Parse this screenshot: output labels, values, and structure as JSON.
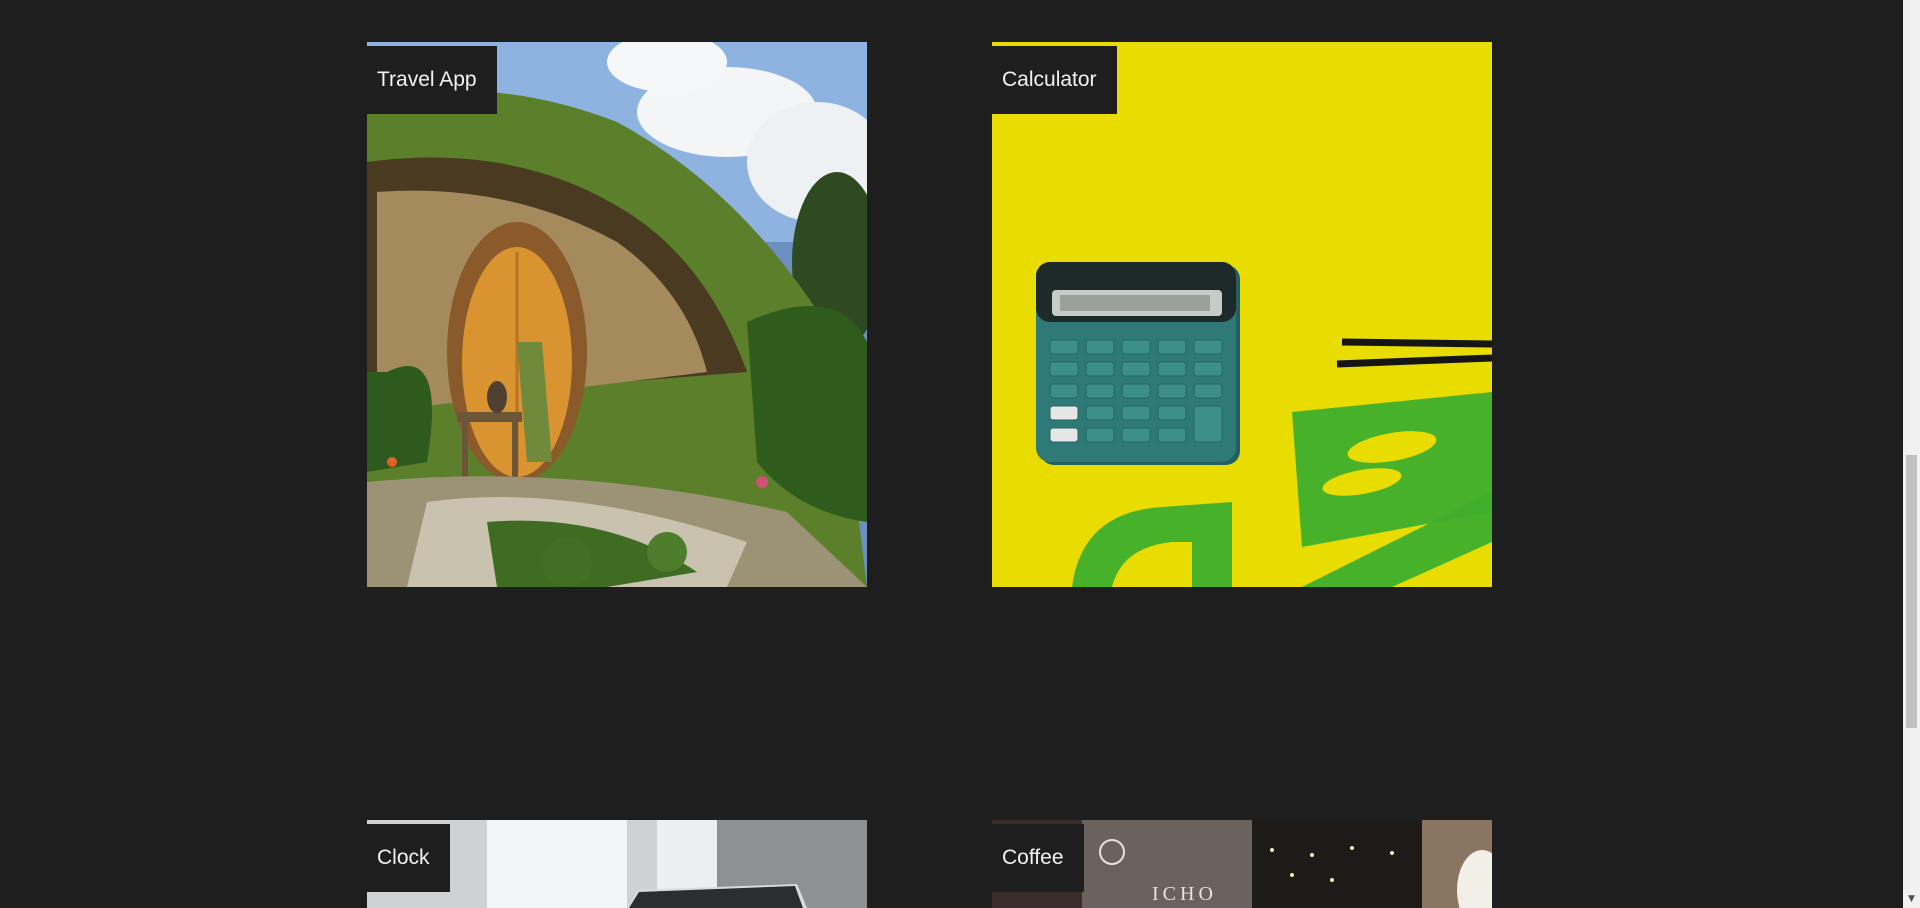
{
  "projects": [
    {
      "label": "Travel App",
      "image": "hobbit-house-image"
    },
    {
      "label": "Calculator",
      "image": "calculator-on-yellow-image"
    },
    {
      "label": "Clock",
      "image": "clock-desk-image"
    },
    {
      "label": "Coffee",
      "image": "coffee-shop-image"
    }
  ],
  "colors": {
    "background": "#1e1e1e",
    "label_bg": "#1e1e1e",
    "label_text": "#f2f2f2",
    "calculator_yellow": "#e8dc00",
    "calculator_teal": "#2f7a77",
    "ruler_green": "#3fae2c"
  },
  "scrollbar": {
    "down_arrow": "▼"
  }
}
